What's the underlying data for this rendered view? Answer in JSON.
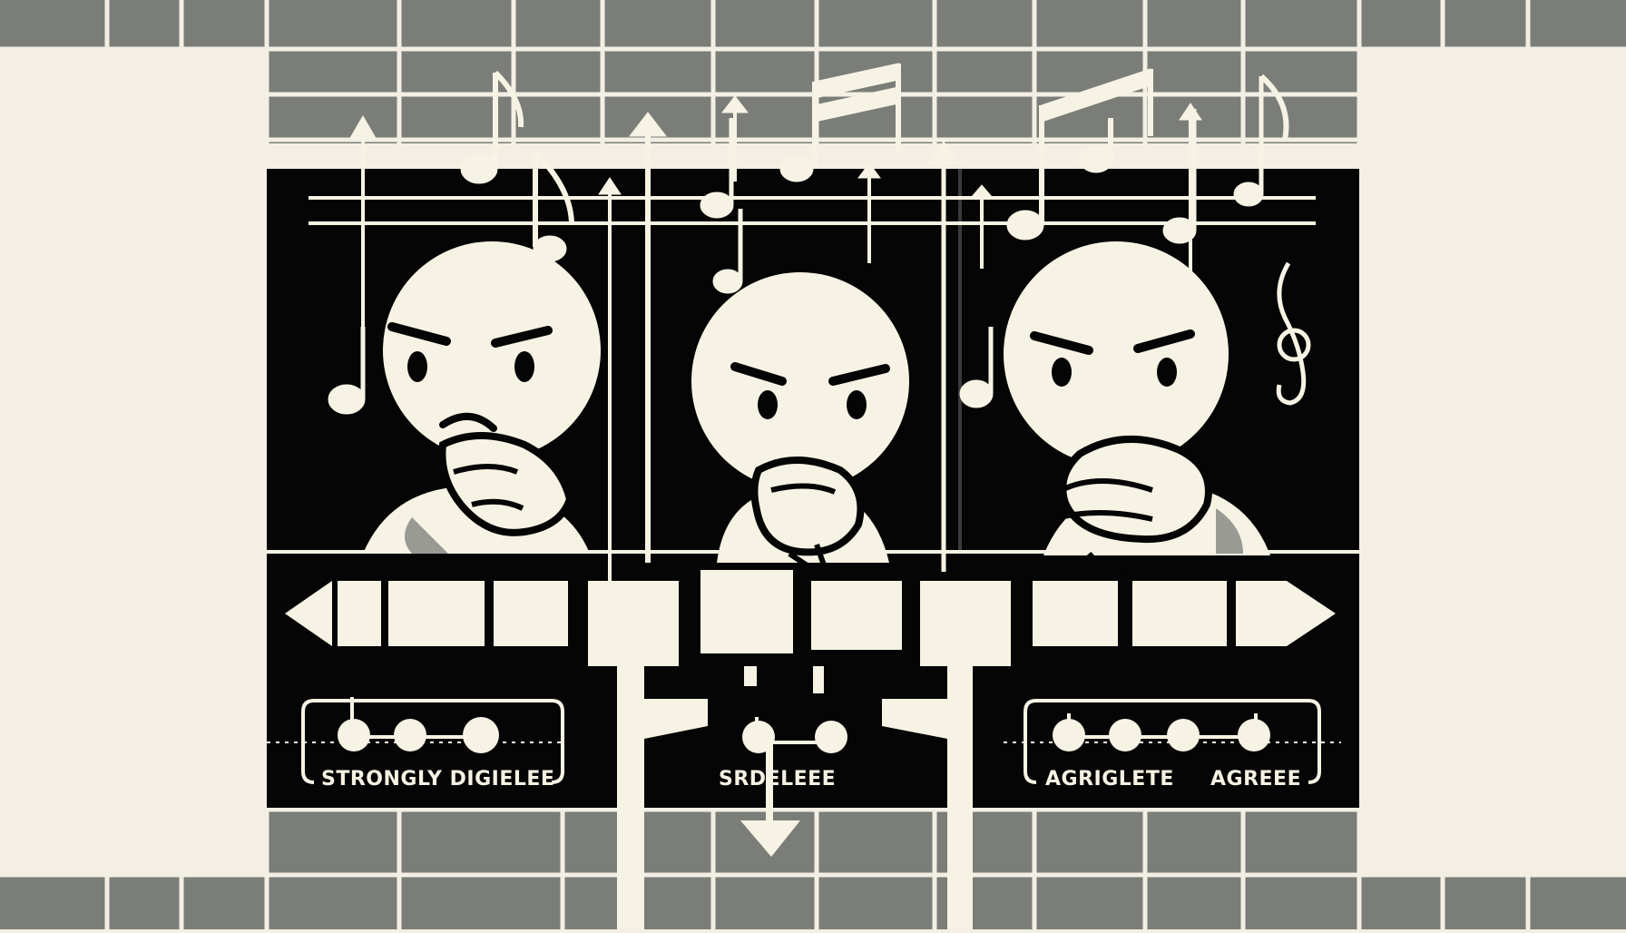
{
  "colors": {
    "background": "#f3efe4",
    "grid_gray": "#7b7e78",
    "panel_black": "#050505",
    "cream": "#f7f3e4",
    "shadow_gray": "#9a9a94"
  },
  "scale": {
    "labels": {
      "left": "STRONGLY DIGIELEE",
      "middle": "SRDELEEE",
      "right_a": "AGRIGLETE",
      "right_b": "AGREEE"
    }
  },
  "characters": [
    {
      "position": "left",
      "expression": "frowning"
    },
    {
      "position": "middle",
      "expression": "frowning"
    },
    {
      "position": "right",
      "expression": "frowning"
    }
  ]
}
